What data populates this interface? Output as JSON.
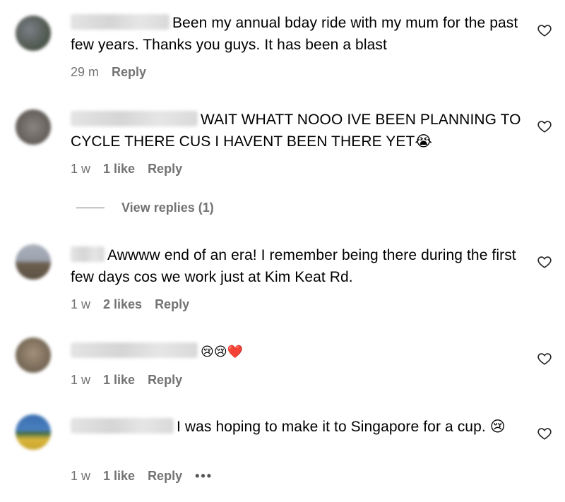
{
  "comments": [
    {
      "text": "Been my annual bday ride with my mum for the past few years. Thanks you guys. It has been a blast",
      "time": "29 m",
      "likes": "",
      "reply": "Reply",
      "avatar_colors": [
        "#6b7280",
        "#3b4a3a"
      ]
    },
    {
      "text": "WAIT WHATT NOOO IVE BEEN PLANNING TO CYCLE THERE CUS I HAVENT BEEN THERE YET😭",
      "time": "1 w",
      "likes": "1 like",
      "reply": "Reply",
      "avatar_colors": [
        "#8a8580",
        "#5f5a55"
      ]
    },
    {
      "text": "Awwww end of an era! I remember being there during the first few days cos we work just at Kim Keat Rd.",
      "name_fragment": "...,",
      "time": "1 w",
      "likes": "2 likes",
      "reply": "Reply",
      "avatar_colors": [
        "#9ca3af",
        "#6b5f4f"
      ]
    },
    {
      "text": "😢😢❤️",
      "time": "1 w",
      "likes": "1 like",
      "reply": "Reply",
      "avatar_colors": [
        "#a3907a",
        "#6e6250"
      ]
    },
    {
      "text": "I was hoping to make it to Singapore for a cup. 😢",
      "time": "1 w",
      "likes": "1 like",
      "reply": "Reply",
      "more": "•••",
      "avatar_colors": [
        "#3b6fb0",
        "#d9b53a"
      ]
    }
  ],
  "view_replies": "View replies (1)"
}
